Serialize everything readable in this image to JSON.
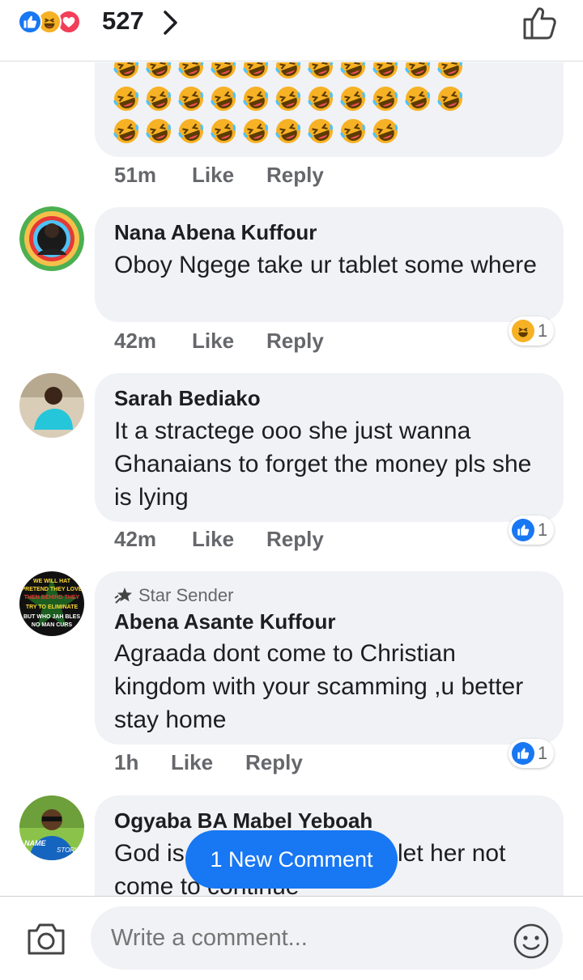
{
  "header": {
    "reaction_count": "527",
    "reaction_icons": [
      "like-icon",
      "haha-icon",
      "love-icon"
    ],
    "chevron_icon": "chevron-right-icon",
    "like_icon": "thumbs-up-icon"
  },
  "comments": [
    {
      "name": "",
      "text": "",
      "emoji": "rolling-on-floor-laughing",
      "emoji_rows": [
        11,
        11,
        9
      ],
      "time": "51m",
      "like": "Like",
      "reply": "Reply"
    },
    {
      "name": "Nana Abena Kuffour",
      "text": "Oboy Ngege take ur tablet some where",
      "time": "42m",
      "like": "Like",
      "reply": "Reply",
      "reaction": {
        "icon": "haha-icon",
        "count": "1"
      }
    },
    {
      "name": "Sarah Bediako",
      "text": "It a stractege ooo she just wanna Ghanaians to forget the money pls she is lying",
      "time": "42m",
      "like": "Like",
      "reply": "Reply",
      "reaction": {
        "icon": "like-icon",
        "count": "1"
      }
    },
    {
      "badge": "Star Sender",
      "name": "Abena Asante Kuffour",
      "text": "Agraada dont come to Christian kingdom with your scamming  ,u better stay home",
      "time": "1h",
      "like": "Like",
      "reply": "Reply",
      "reaction": {
        "icon": "like-icon",
        "count": "1"
      },
      "avatar_text": [
        "WE WILL HAT",
        "PRETEND THEY LOVE",
        "THEN BEHIND THEY",
        "TRY TO ELIMINATE",
        "BUT WHO JAH BLES",
        "NO MAN CURS"
      ]
    },
    {
      "name": "Ogyaba BA Mabel Yeboah",
      "text_left": "God is",
      "text_right": "let her not",
      "text_line2": "come to continue",
      "avatar_text": [
        "NAME",
        "STORY"
      ]
    }
  ],
  "new_comment": {
    "label": "1 New Comment"
  },
  "composer": {
    "placeholder": "Write a comment...",
    "camera_icon": "camera-icon",
    "emoji_icon": "smiley-icon"
  },
  "colors": {
    "accent": "#1877f2",
    "bubble": "#f0f2f5",
    "meta": "#65676b",
    "text": "#1c1e21",
    "love": "#f33e58",
    "haha": "#f7b125"
  }
}
